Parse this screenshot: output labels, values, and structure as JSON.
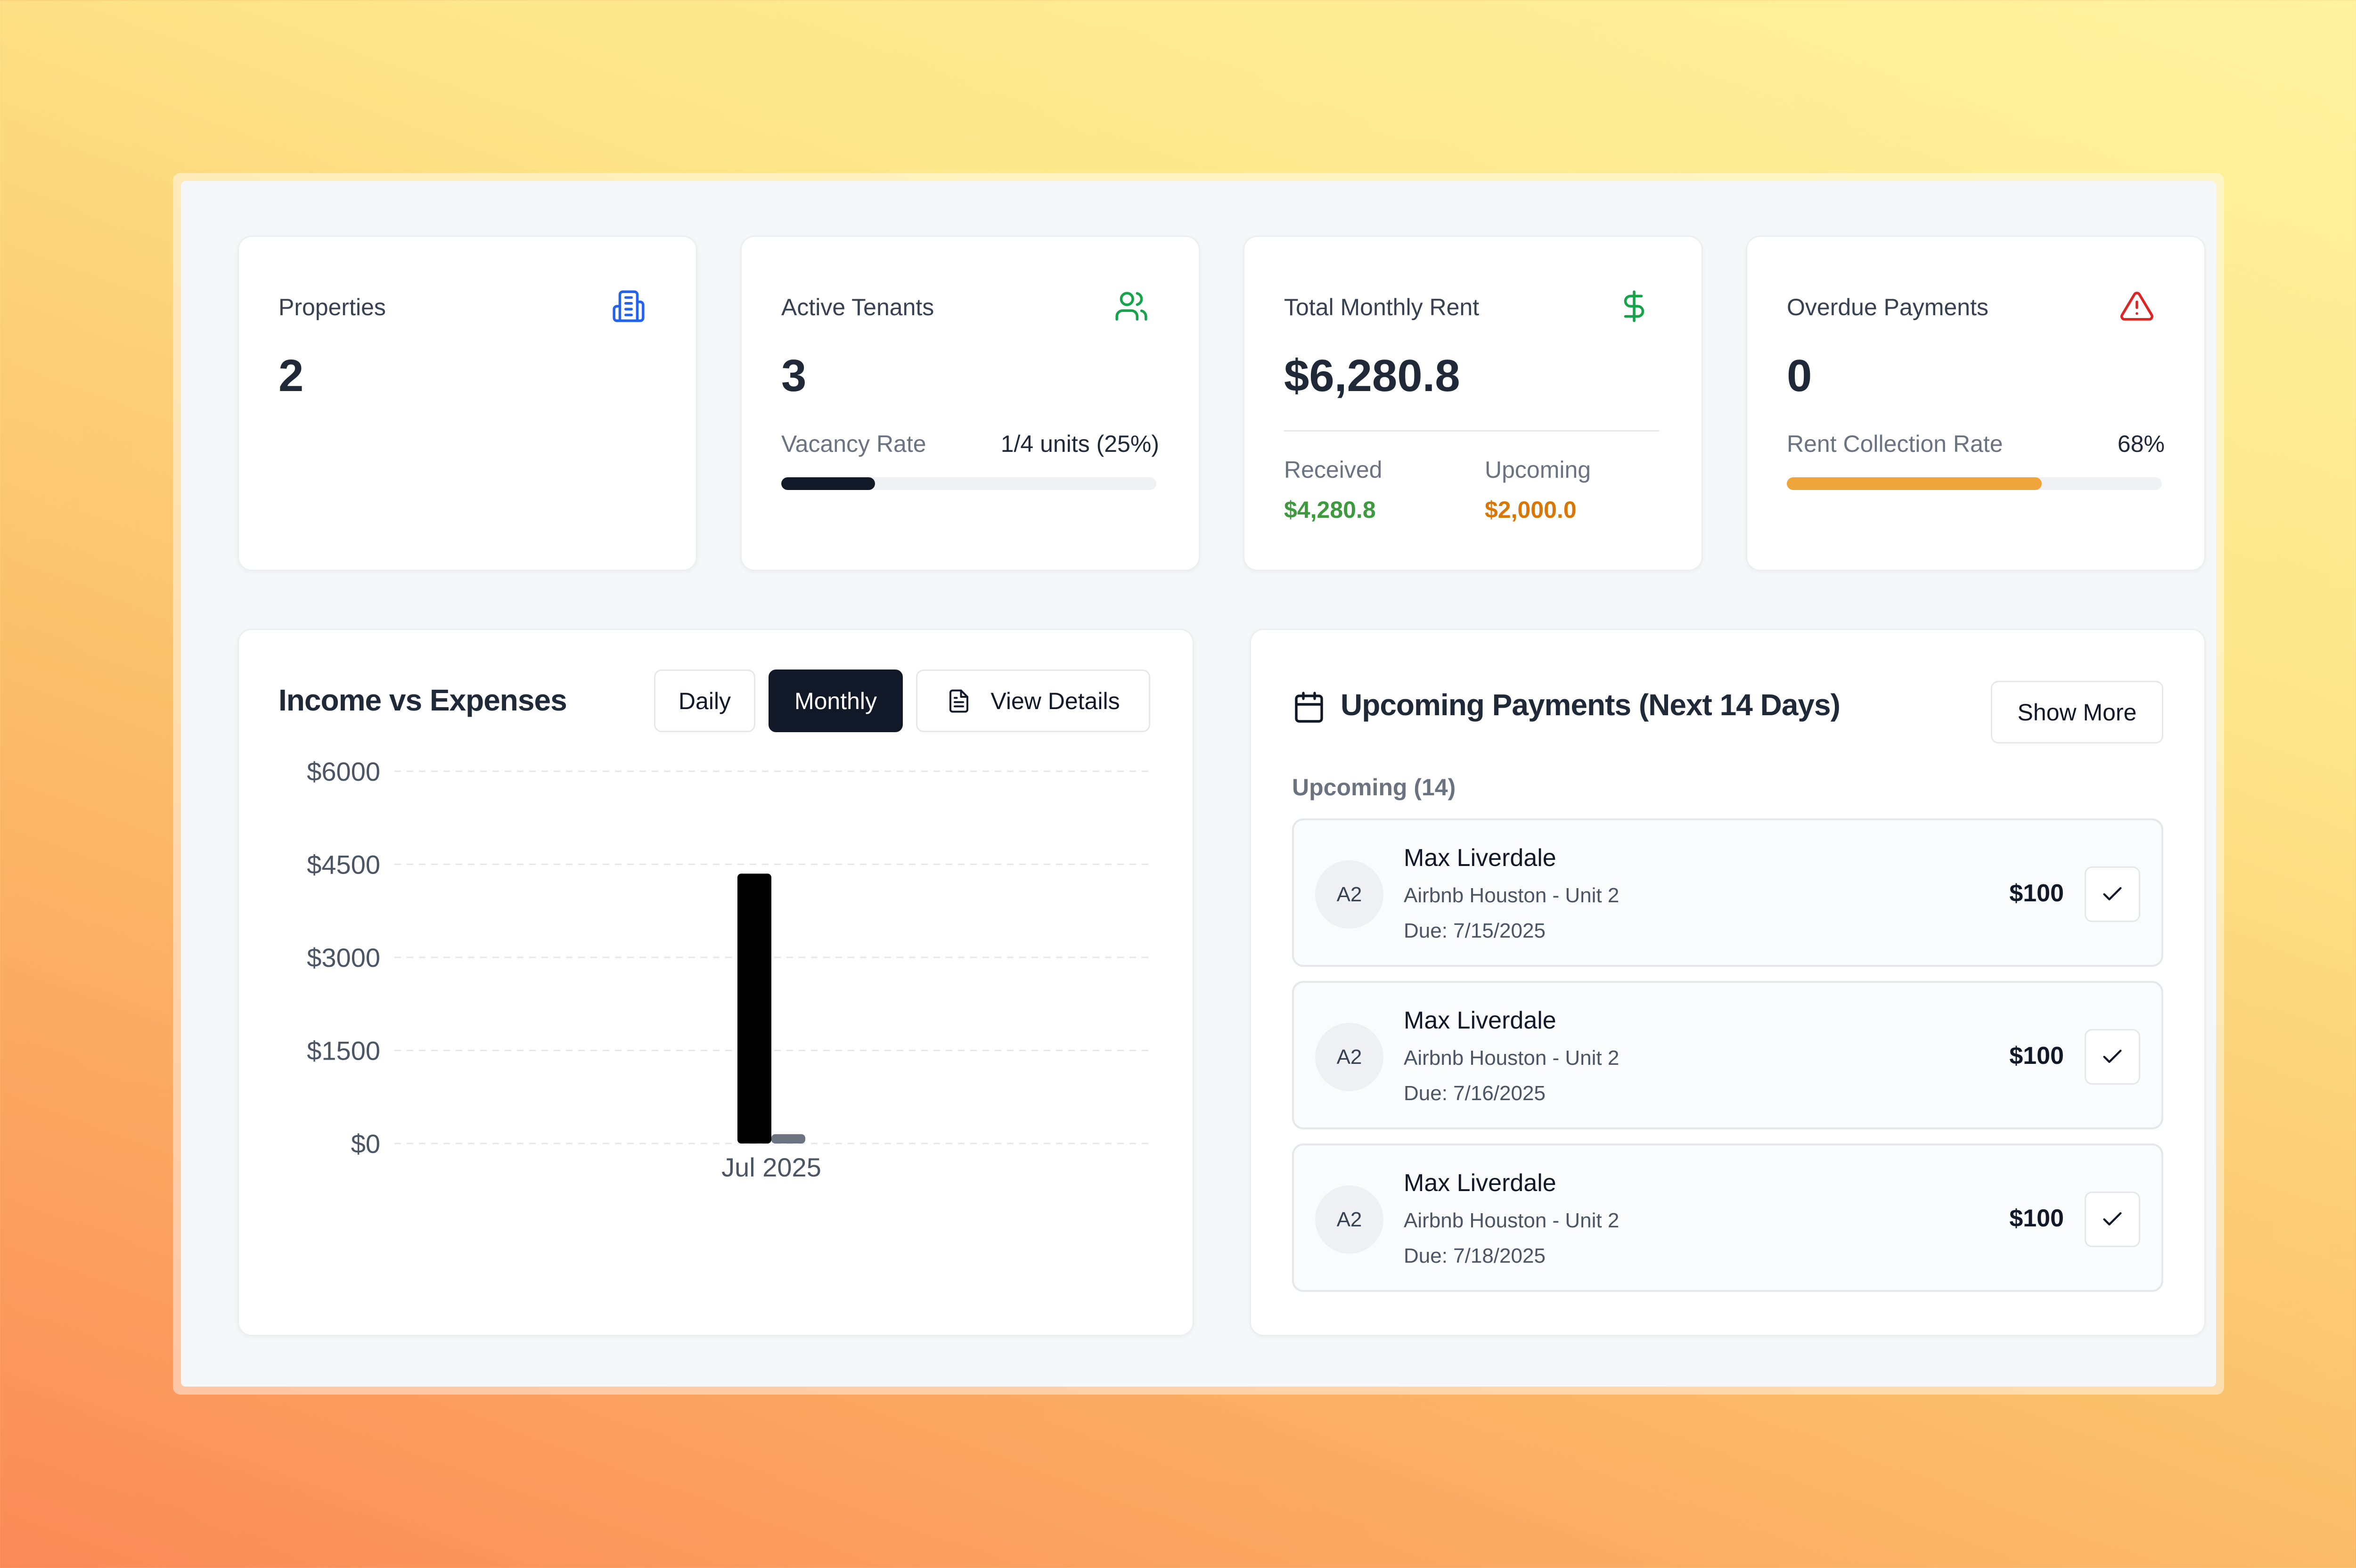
{
  "stats": {
    "properties": {
      "title": "Properties",
      "value": "2",
      "icon": "building-icon"
    },
    "tenants": {
      "title": "Active Tenants",
      "value": "3",
      "icon": "users-icon",
      "vacancy_label": "Vacancy Rate",
      "vacancy_value": "1/4 units (25%)",
      "vacancy_fraction": 0.25
    },
    "rent": {
      "title": "Total Monthly Rent",
      "value": "$6,280.8",
      "icon": "dollar-icon",
      "received_label": "Received",
      "received_value": "$4,280.8",
      "upcoming_label": "Upcoming",
      "upcoming_value": "$2,000.0"
    },
    "overdue": {
      "title": "Overdue Payments",
      "value": "0",
      "icon": "alert-triangle-icon",
      "collection_label": "Rent Collection Rate",
      "collection_value": "68%",
      "collection_fraction": 0.68
    }
  },
  "income": {
    "title": "Income vs Expenses",
    "daily_label": "Daily",
    "monthly_label": "Monthly",
    "details_label": "View Details",
    "active_period": "Monthly"
  },
  "chart_data": {
    "type": "bar",
    "categories": [
      "Jul 2025"
    ],
    "series": [
      {
        "values": [
          4350
        ],
        "color": "#000000"
      },
      {
        "values": [
          150
        ],
        "color": "#6b7280"
      }
    ],
    "yticks": [
      "$0",
      "$1500",
      "$3000",
      "$4500",
      "$6000"
    ],
    "ylim": [
      0,
      6000
    ],
    "grid": true,
    "title": "",
    "xlabel": "",
    "ylabel": ""
  },
  "payments": {
    "title": "Upcoming Payments (Next 14 Days)",
    "show_more_label": "Show More",
    "section_label": "Upcoming (14)",
    "items": [
      {
        "initials": "A2",
        "name": "Max Liverdale",
        "property": "Airbnb Houston - Unit 2",
        "due": "Due: 7/15/2025",
        "amount": "$100"
      },
      {
        "initials": "A2",
        "name": "Max Liverdale",
        "property": "Airbnb Houston - Unit 2",
        "due": "Due: 7/16/2025",
        "amount": "$100"
      },
      {
        "initials": "A2",
        "name": "Max Liverdale",
        "property": "Airbnb Houston - Unit 2",
        "due": "Due: 7/18/2025",
        "amount": "$100"
      }
    ]
  },
  "colors": {
    "green": "#16a34a",
    "orange": "#d97706",
    "red": "#dc2626",
    "blue": "#2563eb",
    "dark": "#111827",
    "progress_orange": "#f0a53a"
  }
}
